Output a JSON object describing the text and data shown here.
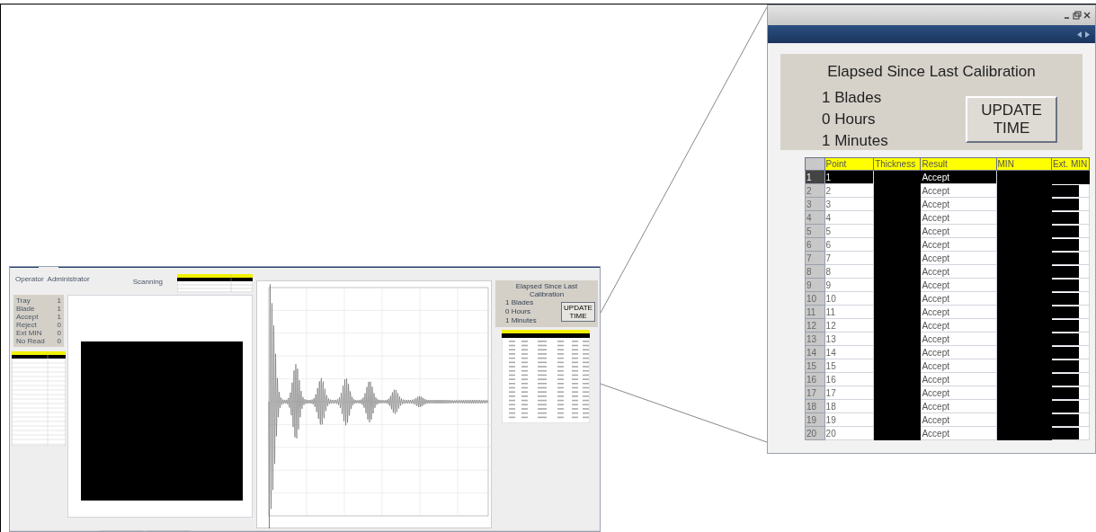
{
  "screenshot": {
    "operator_label": "Operator",
    "operator": "Administrator",
    "status": "Scanning",
    "counters": [
      {
        "label": "Tray",
        "value": "1"
      },
      {
        "label": "Blade",
        "value": "1"
      },
      {
        "label": "Accept",
        "value": "1"
      },
      {
        "label": "Reject",
        "value": "0"
      },
      {
        "label": "Ext MIN",
        "value": "0"
      },
      {
        "label": "No Read",
        "value": "0"
      }
    ],
    "calibration": {
      "title": "Elapsed Since Last Calibration",
      "counts": [
        "1 Blades",
        "0 Hours",
        "1 Minutes"
      ],
      "button": "UPDATE TIME"
    }
  },
  "zoomed": {
    "calibration": {
      "title": "Elapsed Since Last Calibration",
      "counts": [
        "1 Blades",
        "0 Hours",
        "1 Minutes"
      ],
      "button": "UPDATE TIME"
    },
    "table": {
      "columns": [
        "Point",
        "Thickness",
        "Result",
        "MIN",
        "Ext. MIN"
      ],
      "rows": [
        {
          "index": "1",
          "point": "1",
          "result": "Accept",
          "selected": true
        },
        {
          "index": "2",
          "point": "2",
          "result": "Accept",
          "selected": false
        },
        {
          "index": "3",
          "point": "3",
          "result": "Accept",
          "selected": false
        },
        {
          "index": "4",
          "point": "4",
          "result": "Accept",
          "selected": false
        },
        {
          "index": "5",
          "point": "5",
          "result": "Accept",
          "selected": false
        },
        {
          "index": "6",
          "point": "6",
          "result": "Accept",
          "selected": false
        },
        {
          "index": "7",
          "point": "7",
          "result": "Accept",
          "selected": false
        },
        {
          "index": "8",
          "point": "8",
          "result": "Accept",
          "selected": false
        },
        {
          "index": "9",
          "point": "9",
          "result": "Accept",
          "selected": false
        },
        {
          "index": "10",
          "point": "10",
          "result": "Accept",
          "selected": false
        },
        {
          "index": "11",
          "point": "11",
          "result": "Accept",
          "selected": false
        },
        {
          "index": "12",
          "point": "12",
          "result": "Accept",
          "selected": false
        },
        {
          "index": "13",
          "point": "13",
          "result": "Accept",
          "selected": false
        },
        {
          "index": "14",
          "point": "14",
          "result": "Accept",
          "selected": false
        },
        {
          "index": "15",
          "point": "15",
          "result": "Accept",
          "selected": false
        },
        {
          "index": "16",
          "point": "16",
          "result": "Accept",
          "selected": false
        },
        {
          "index": "17",
          "point": "17",
          "result": "Accept",
          "selected": false
        },
        {
          "index": "18",
          "point": "18",
          "result": "Accept",
          "selected": false
        },
        {
          "index": "19",
          "point": "19",
          "result": "Accept",
          "selected": false
        },
        {
          "index": "20",
          "point": "20",
          "result": "Accept",
          "selected": false
        }
      ]
    }
  }
}
